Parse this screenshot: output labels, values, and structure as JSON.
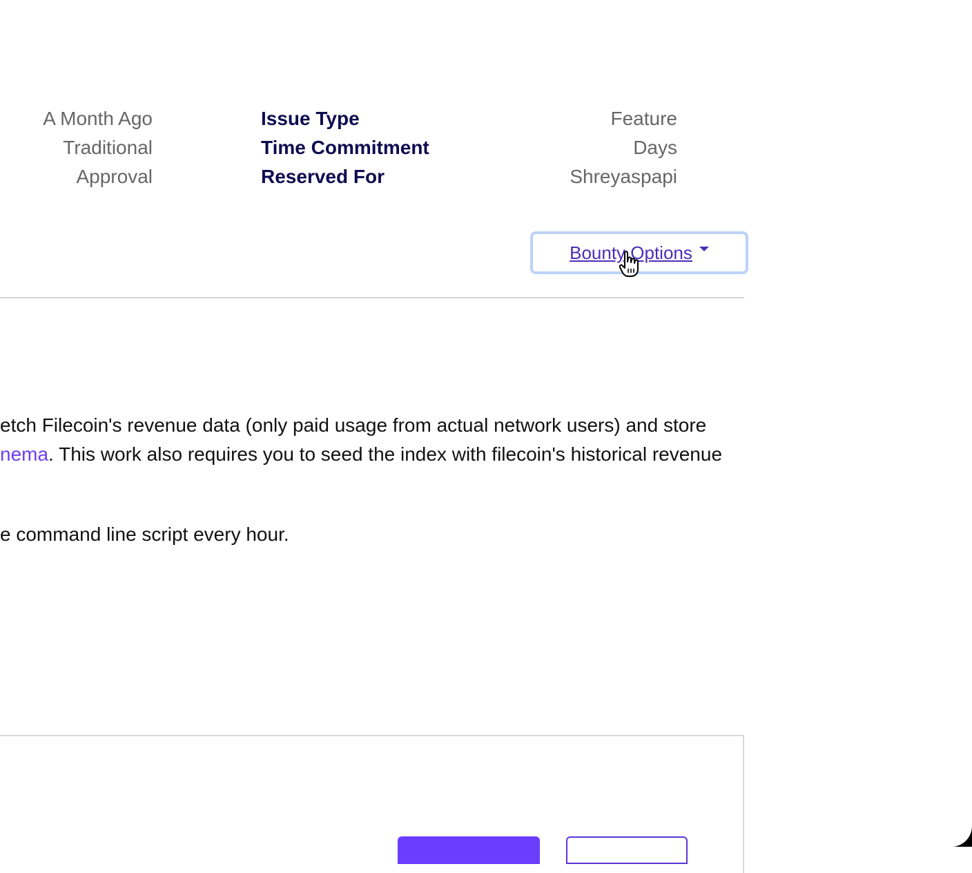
{
  "details": {
    "left_values": [
      "A Month Ago",
      "Traditional",
      "Approval"
    ],
    "labels": [
      "Issue Type",
      "Time Commitment",
      "Reserved For"
    ],
    "right_values": [
      "Feature",
      "Days",
      "Shreyaspapi"
    ]
  },
  "bounty_options": {
    "label": "Bounty Options "
  },
  "description": {
    "line1": "etch Filecoin's revenue data (only paid usage from actual network users) and store",
    "line2_link": "nema",
    "line2_rest": ". This work also requires you to seed the index with filecoin's historical revenue",
    "line3": "e command line script every hour."
  },
  "icons": {
    "cursor": "hand-pointer-icon",
    "caret": "caret-down-icon"
  },
  "colors": {
    "label": "#0d0a4f",
    "value": "#666666",
    "link": "#6d3ff0",
    "primary": "#6a3dff",
    "focus_ring": "#bcd2f8"
  }
}
